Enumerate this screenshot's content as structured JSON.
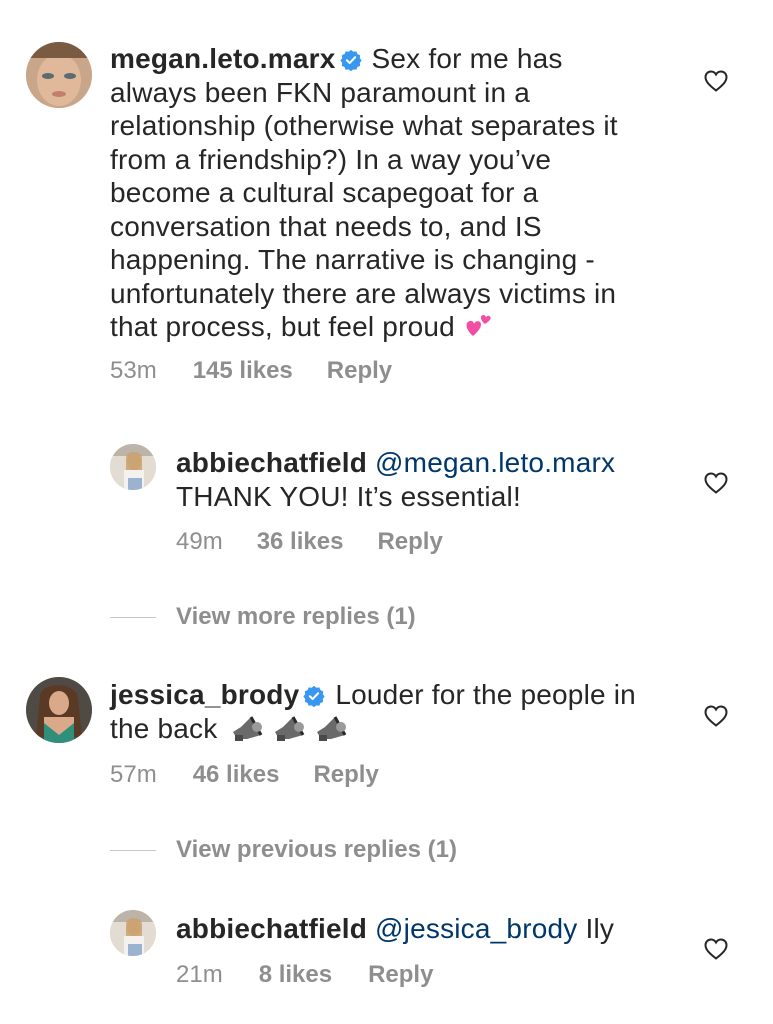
{
  "comments": [
    {
      "username": "megan.leto.marx",
      "verified": true,
      "text_lines": [
        "Sex for me has",
        "always been FKN paramount in a",
        "relationship (otherwise what separates it",
        "from a friendship?) In a way you’ve",
        "become a cultural scapegoat for a",
        "conversation that needs to, and IS",
        "happening. The narrative is changing -",
        "unfortunately there are always victims in",
        "that process, but feel proud"
      ],
      "emoji": "two-hearts",
      "time": "53m",
      "likes": "145 likes",
      "reply": "Reply"
    },
    {
      "username": "abbiechatfield",
      "mention": "@megan.leto.marx",
      "text_line2": "THANK YOU! It’s essential!",
      "time": "49m",
      "likes": "36 likes",
      "reply": "Reply"
    },
    {
      "view_replies": "View more replies (1)"
    },
    {
      "username": "jessica_brody",
      "verified": true,
      "text_line1": "Louder for the people in",
      "text_line2": "the back",
      "emoji": "loudspeaker x3",
      "time": "57m",
      "likes": "46 likes",
      "reply": "Reply"
    },
    {
      "view_replies": "View previous replies (1)"
    },
    {
      "username": "abbiechatfield",
      "mention": "@jessica_brody",
      "text_after": "Ily",
      "time": "21m",
      "likes": "8 likes",
      "reply": "Reply"
    }
  ],
  "colors": {
    "text": "#262626",
    "meta": "#8e8e8e",
    "mention": "#00376b",
    "verified": "#3897f0"
  }
}
